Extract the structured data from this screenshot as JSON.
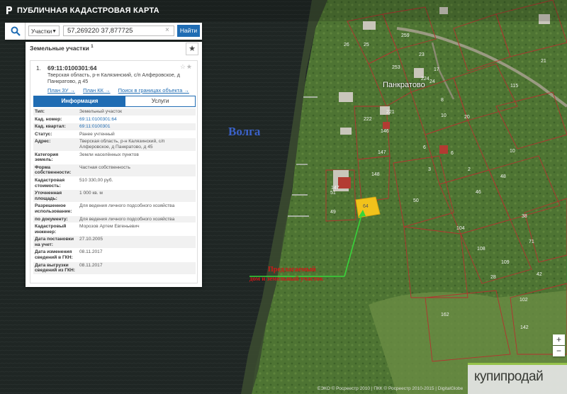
{
  "app": {
    "title": "ПУБЛИЧНАЯ КАДАСТРОВАЯ КАРТА",
    "logo": "rosreestr-logo"
  },
  "search": {
    "type_label": "Участки",
    "value": "57,269220 37,877725",
    "button": "Найти",
    "clear": "×"
  },
  "panel": {
    "title": "Земельные участки",
    "count": "1",
    "result": {
      "index": "1.",
      "cad_number": "69:11:0100301:64",
      "address": "Тверская область, р-н Калязинский, с/п Алферовское, д Панкратово, д 45",
      "links": [
        "План ЗУ →",
        "План КК →",
        "Поиск в границах объекта →"
      ],
      "tabs": {
        "info": "Информация",
        "services": "Услуги"
      },
      "properties": [
        {
          "k": "Тип:",
          "v": "Земельный участок"
        },
        {
          "k": "Кад. номер:",
          "v": "69:11:0100301:64",
          "link": true
        },
        {
          "k": "Кад. квартал:",
          "v": "69:11:0100301",
          "link": true
        },
        {
          "k": "Статус:",
          "v": "Ранее учтенный"
        },
        {
          "k": "Адрес:",
          "v": "Тверская область, р-н Калязинский, с/п Алферовское, д Панкратово, д 45"
        },
        {
          "k": "Категория земель:",
          "v": "Земли населённых пунктов"
        },
        {
          "k": "Форма собственности:",
          "v": "Частная собственность"
        },
        {
          "k": "Кадастровая стоимость:",
          "v": "510 330,00 руб."
        },
        {
          "k": "Уточненная площадь:",
          "v": "1 000 кв. м"
        },
        {
          "k": "Разрешенное использование:",
          "v": "Для ведения личного подсобного хозяйства"
        },
        {
          "k": "по документу:",
          "v": "Для ведения личного подсобного хозяйства"
        },
        {
          "k": "Кадастровый инженер:",
          "v": "Морозов Артем Евгеньевич"
        },
        {
          "k": "Дата постановки на учет:",
          "v": "27.10.2005"
        },
        {
          "k": "Дата изменения сведений в ГКН:",
          "v": "08.11.2017"
        },
        {
          "k": "Дата выгрузки сведений из ГКН:",
          "v": "08.11.2017"
        }
      ]
    }
  },
  "map": {
    "labels": {
      "river": "Волга",
      "village": "Панкратово",
      "annotation_line1": "Предлагаемый",
      "annotation_line2": "дом и земельный участок",
      "selected_parcel": "64"
    },
    "parcel_numbers": [
      "259",
      "26",
      "25",
      "253",
      "23",
      "21",
      "224",
      "24",
      "17",
      "115",
      "20",
      "8",
      "6",
      "221",
      "222",
      "147",
      "146",
      "10",
      "148",
      "6",
      "147",
      "3",
      "2",
      "10",
      "48",
      "51",
      "46",
      "50",
      "49",
      "104",
      "109",
      "108",
      "28",
      "38",
      "71",
      "42",
      "102",
      "162",
      "142"
    ],
    "zoom_in": "+",
    "zoom_out": "−",
    "attribution": "ЕЭКО © Росреестр 2010 | ПКК © Росреестр 2010-2015 | DigitalGlobe"
  },
  "watermark": "купипродай",
  "colors": {
    "accent": "#1f6cb3",
    "parcel_line": "#b5322f",
    "selected": "#f2c21b",
    "annotation": "#d01818",
    "arrow": "#37d43a"
  }
}
